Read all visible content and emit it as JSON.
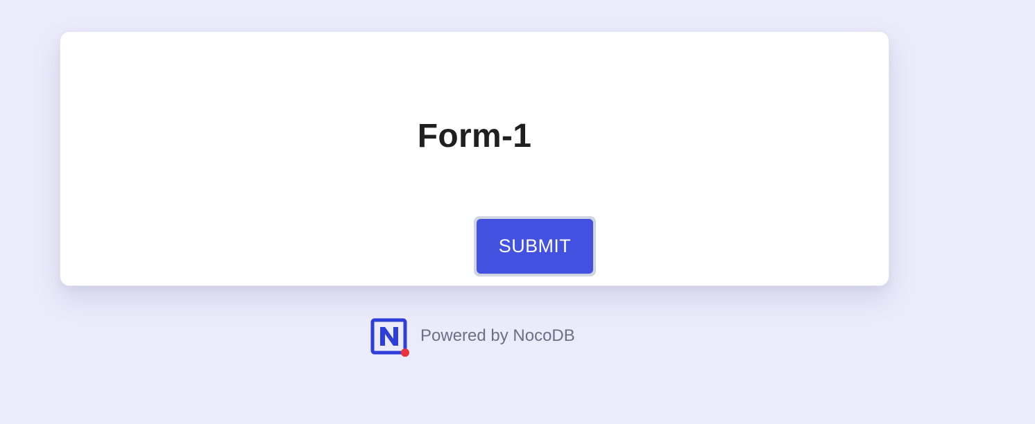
{
  "form": {
    "title": "Form-1",
    "submit_label": "SUBMIT"
  },
  "footer": {
    "logo_icon": "nocodb-logo-icon",
    "powered_text": "Powered by NocoDB"
  },
  "colors": {
    "page_background": "#EBEBFB",
    "card_background": "#FFFFFF",
    "submit_button": "#4351E0",
    "submit_text": "#FFFFFF",
    "logo_blue": "#2D3FD8",
    "logo_dot": "#E8323F",
    "footer_text": "#6B7084"
  }
}
